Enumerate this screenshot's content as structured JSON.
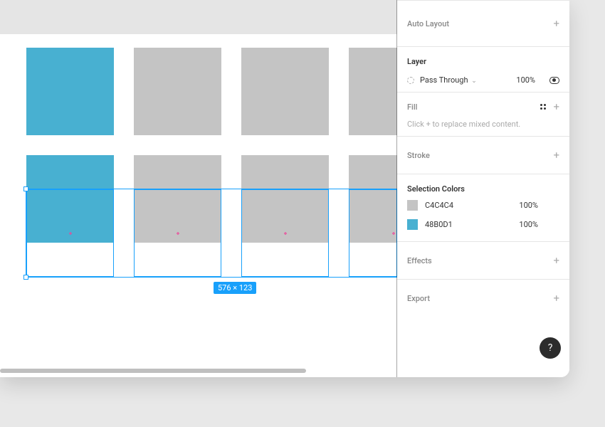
{
  "selection_badge": "576 × 123",
  "panel": {
    "auto_layout": {
      "label": "Auto Layout"
    },
    "layer": {
      "label": "Layer",
      "blend_mode": "Pass Through",
      "opacity": "100%"
    },
    "fill": {
      "label": "Fill",
      "hint": "Click + to replace mixed content."
    },
    "stroke": {
      "label": "Stroke"
    },
    "selection_colors": {
      "label": "Selection Colors",
      "items": [
        {
          "hex": "C4C4C4",
          "opacity": "100%",
          "swatch": "gray"
        },
        {
          "hex": "48B0D1",
          "opacity": "100%",
          "swatch": "blue"
        }
      ]
    },
    "effects": {
      "label": "Effects"
    },
    "export": {
      "label": "Export"
    }
  },
  "help_label": "?",
  "colors": {
    "brand_blue": "#48b0d1",
    "selection_blue": "#18a0fb",
    "gray": "#c4c4c4"
  }
}
